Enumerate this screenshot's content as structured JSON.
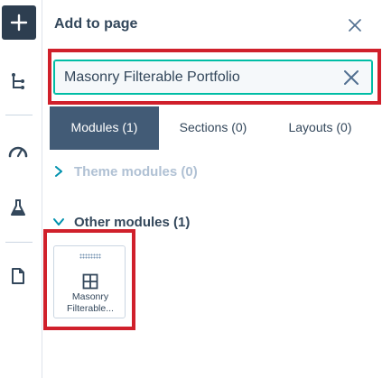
{
  "rail": {
    "add_icon": "plus-icon",
    "items": [
      {
        "icon": "tree-structure-icon"
      },
      {
        "icon": "gauge-icon"
      },
      {
        "icon": "flask-icon"
      },
      {
        "icon": "document-icon"
      }
    ]
  },
  "panel": {
    "title": "Add to page",
    "close_icon": "close-icon"
  },
  "search": {
    "value": "Masonry Filterable Portfolio",
    "clear_icon": "close-icon"
  },
  "tabs": [
    {
      "label": "Modules (1)",
      "active": true
    },
    {
      "label": "Sections (0)",
      "active": false
    },
    {
      "label": "Layouts (0)",
      "active": false
    }
  ],
  "groups": [
    {
      "label": "Theme modules (0)",
      "expanded": false
    },
    {
      "label": "Other modules (1)",
      "expanded": true
    }
  ],
  "module_card": {
    "icon": "grid-icon",
    "label_line1": "Masonry",
    "label_line2": "Filterable..."
  },
  "colors": {
    "highlight": "#d0202b",
    "accent": "#00bda5",
    "tab_active": "#425b76",
    "text": "#33475b"
  }
}
